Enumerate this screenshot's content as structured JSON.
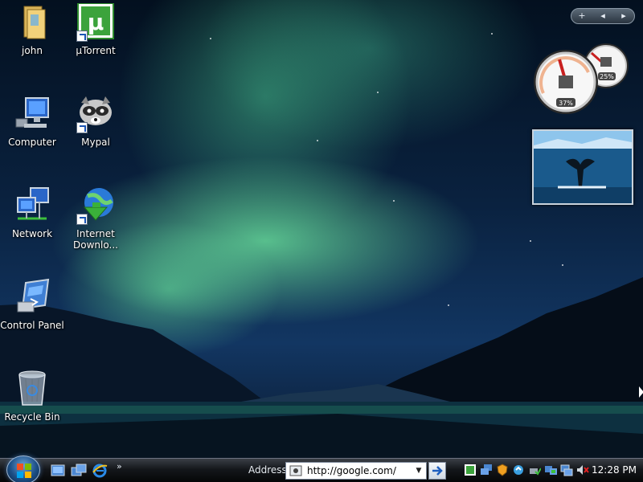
{
  "desktop": {
    "icons": [
      {
        "label": "john",
        "icon": "user-folder-icon"
      },
      {
        "label": "µTorrent",
        "icon": "utorrent-icon",
        "glyph": "µ"
      },
      {
        "label": "Computer",
        "icon": "computer-icon"
      },
      {
        "label": "Mypal",
        "icon": "mypal-raccoon-icon"
      },
      {
        "label": "Network",
        "icon": "network-icon"
      },
      {
        "label": "Internet Downlo...",
        "icon": "internet-download-manager-icon"
      },
      {
        "label": "Control Panel",
        "icon": "control-panel-icon"
      },
      {
        "label": "Recycle Bin",
        "icon": "recycle-bin-icon"
      }
    ]
  },
  "gadgets": {
    "controls": {
      "add": "+",
      "prev": "◂",
      "next": "▸"
    },
    "cpu_meter": {
      "cpu_percent_label": "37%",
      "memory_percent_label": "25%",
      "cpu": 0.37,
      "memory": 0.25
    },
    "slideshow": {
      "subject": "whale-tail-photo"
    }
  },
  "taskbar": {
    "start": {
      "icon": "windows-start-orb-icon"
    },
    "quick_launch": [
      {
        "icon": "show-desktop-icon"
      },
      {
        "icon": "switch-windows-icon"
      },
      {
        "icon": "internet-explorer-icon"
      }
    ],
    "quick_launch_more": "»",
    "address": {
      "label": "Address",
      "value": "http://google.com/",
      "dropdown": "▼",
      "go_icon": "go-arrow-icon"
    },
    "tray": {
      "icons": [
        "utorrent-tray-icon",
        "network-tray-icon",
        "security-shield-icon",
        "update-icon",
        "safely-remove-icon",
        "network-status-icon",
        "volume-muted-icon"
      ],
      "time": "12:28 PM"
    }
  },
  "colors": {
    "aurora": "#6ef0a0",
    "sky": "#0a2240",
    "taskbar": "#14171b"
  }
}
